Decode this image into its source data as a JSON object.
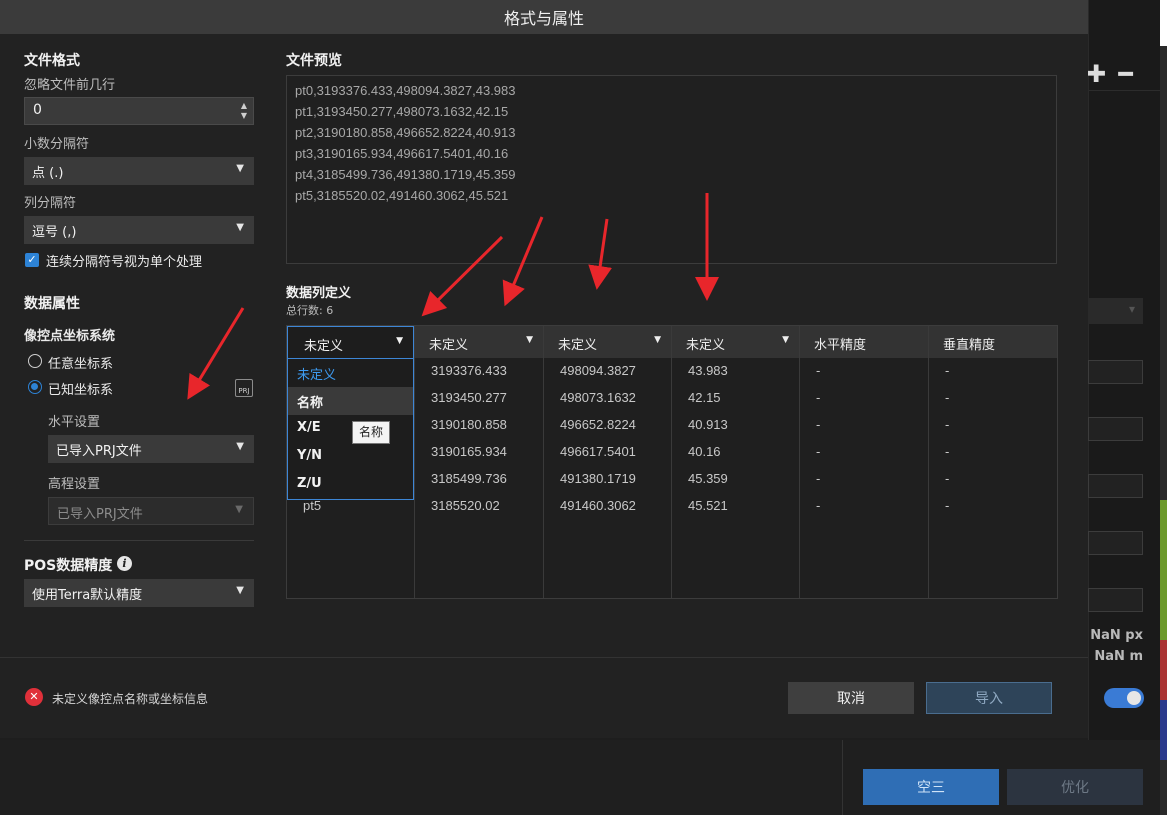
{
  "dialog": {
    "title": "格式与属性"
  },
  "file_format": {
    "title": "文件格式",
    "skip_label": "忽略文件前几行",
    "skip_value": "0",
    "decimal_label": "小数分隔符",
    "decimal_value": "点 (.)",
    "column_label": "列分隔符",
    "column_value": "逗号 (,)",
    "merge_label": "连续分隔符号视为单个处理"
  },
  "data_props": {
    "title": "数据属性",
    "crs_label": "像控点坐标系统",
    "radio_any": "任意坐标系",
    "radio_known": "已知坐标系",
    "prj_icon": "PRJ",
    "horizontal_label": "水平设置",
    "horizontal_value": "已导入PRJ文件",
    "vertical_label": "高程设置",
    "vertical_value": "已导入PRJ文件"
  },
  "pos": {
    "title": "POS数据精度",
    "info_icon": "i",
    "value": "使用Terra默认精度"
  },
  "preview": {
    "title": "文件预览",
    "lines": [
      "pt0,3193376.433,498094.3827,43.983",
      "pt1,3193450.277,498073.1632,42.15",
      "pt2,3190180.858,496652.8224,40.913",
      "pt3,3190165.934,496617.5401,40.16",
      "pt4,3185499.736,491380.1719,45.359",
      "pt5,3185520.02,491460.3062,45.521"
    ]
  },
  "columns": {
    "title": "数据列定义",
    "row_count": "总行数: 6",
    "headers": [
      "未定义",
      "未定义",
      "未定义",
      "未定义",
      "水平精度",
      "垂直精度"
    ],
    "col0_visible": [
      "pt5"
    ],
    "col1": [
      "3193376.433",
      "3193450.277",
      "3190180.858",
      "3190165.934",
      "3185499.736",
      "3185520.02"
    ],
    "col2": [
      "498094.3827",
      "498073.1632",
      "496652.8224",
      "496617.5401",
      "491380.1719",
      "491460.3062"
    ],
    "col3": [
      "43.983",
      "42.15",
      "40.913",
      "40.16",
      "45.359",
      "45.521"
    ],
    "col4": [
      "-",
      "-",
      "-",
      "-",
      "-",
      "-"
    ],
    "col5": [
      "-",
      "-",
      "-",
      "-",
      "-",
      "-"
    ]
  },
  "dropdown": {
    "selected": "未定义",
    "options": [
      "未定义",
      "名称",
      "X/E",
      "Y/N",
      "Z/U"
    ],
    "tooltip": "名称"
  },
  "footer": {
    "error_icon": "✕",
    "error_text": "未定义像控点名称或坐标信息",
    "cancel": "取消",
    "import": "导入"
  },
  "background": {
    "zoom_controls": "✚ ━",
    "nan_px": "NaN px",
    "nan_m": "NaN m",
    "btn_aerial": "空三",
    "btn_optimize": "优化"
  },
  "colors": {
    "accent": "#2d83d6",
    "error": "#e0303a",
    "arrow": "#e8262b"
  }
}
